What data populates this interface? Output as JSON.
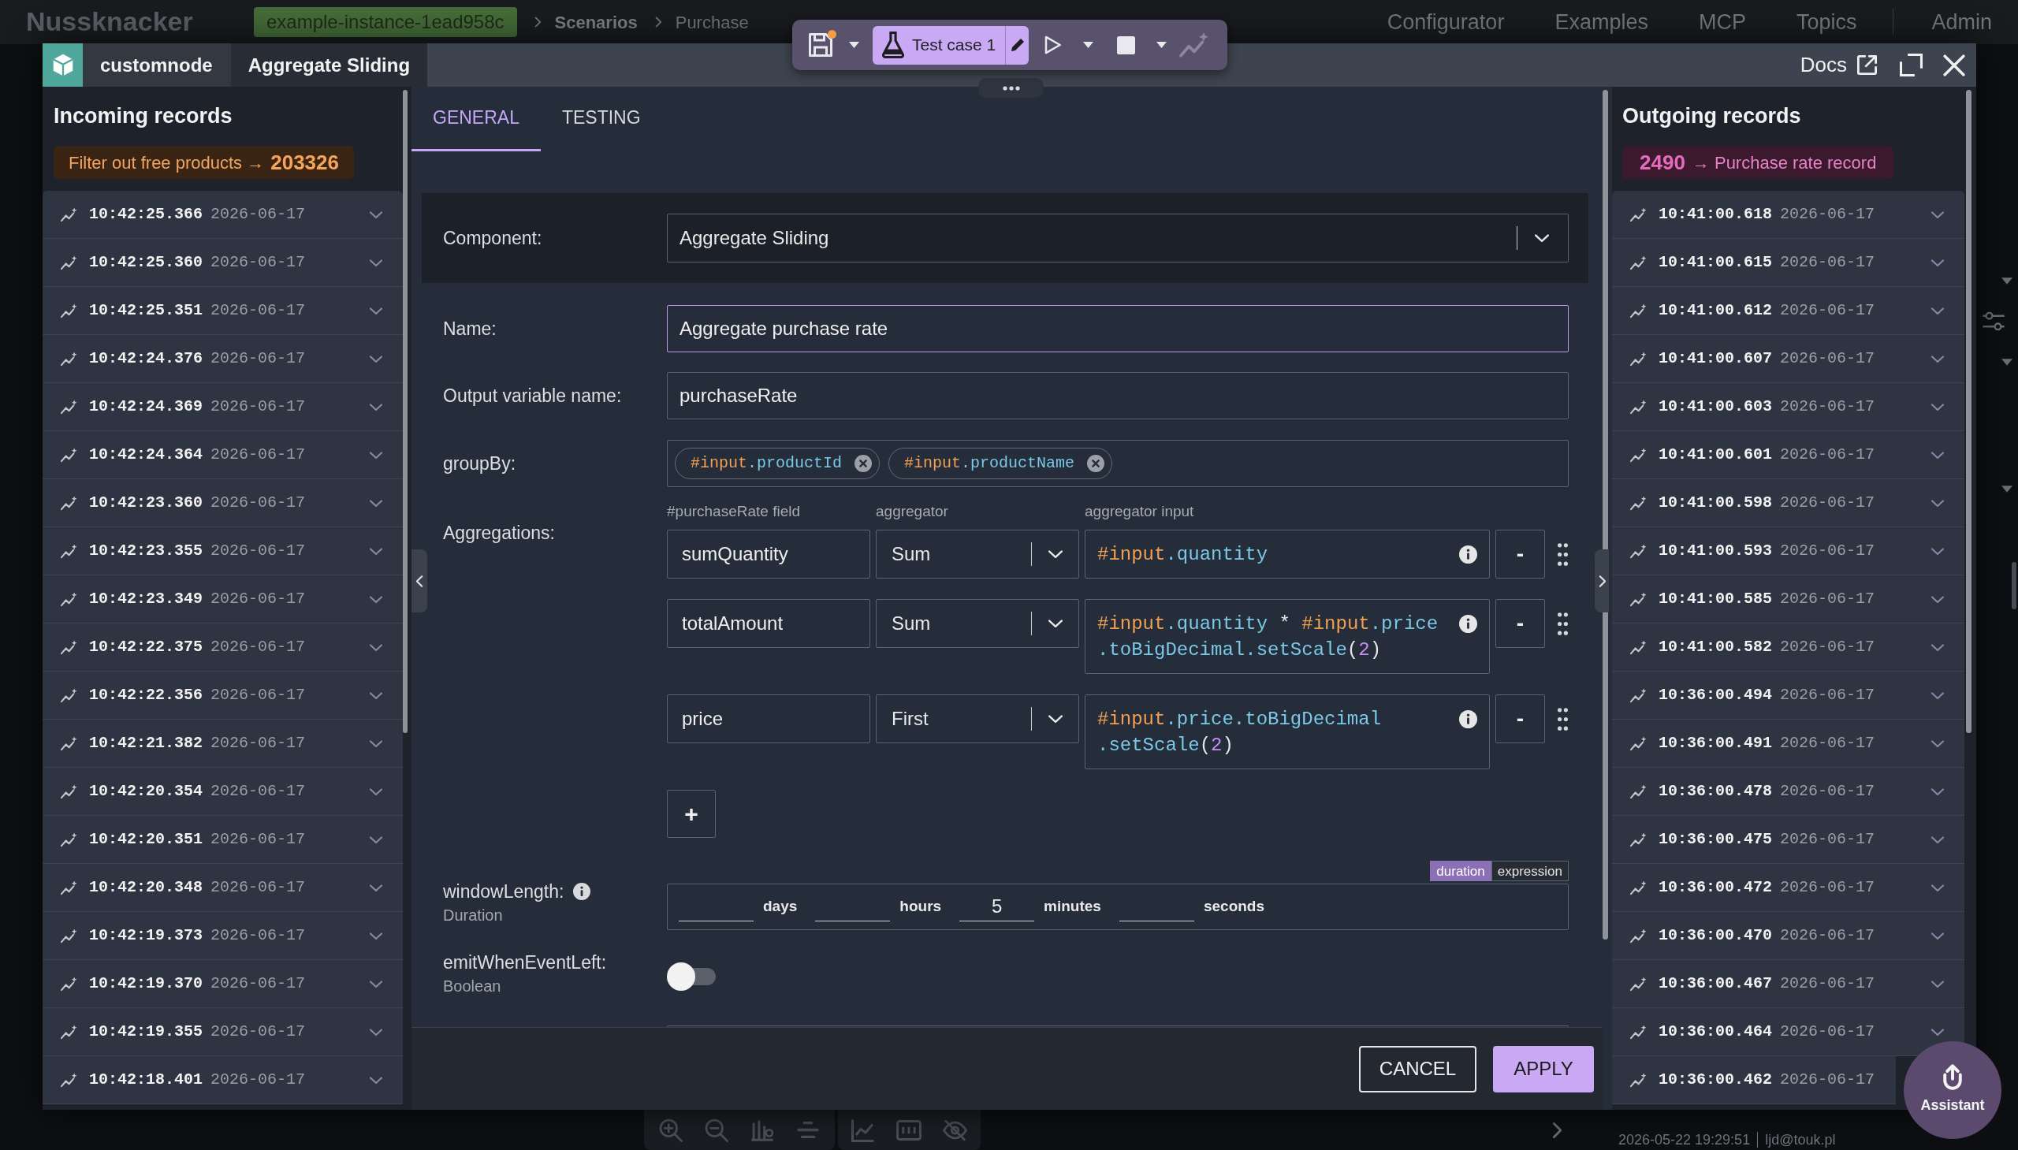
{
  "app_bar": {
    "logo": "Nussknacker",
    "environment": "example-instance-1ead958c",
    "breadcrumbs": [
      {
        "label": "Scenarios",
        "kind": "section"
      },
      {
        "label": "Purchase",
        "kind": "scenario"
      }
    ],
    "nav_links": [
      {
        "label": "Configurator",
        "kind": "link"
      },
      {
        "label": "Examples",
        "kind": "link"
      },
      {
        "label": "MCP",
        "kind": "link"
      },
      {
        "label": "Topics",
        "kind": "link"
      },
      {
        "label": "Admin",
        "kind": "account"
      }
    ]
  },
  "toolbar": {
    "unsaved_changes": true,
    "test_case": "Test case 1"
  },
  "window": {
    "node_type": "customnode",
    "node_name": "Aggregate Sliding",
    "docs_link": "Docs"
  },
  "incoming": {
    "title": "Incoming records",
    "source": "Filter out free products →",
    "count": "203326",
    "records": [
      {
        "time": "10:42:25.366",
        "date": "2026-06-17"
      },
      {
        "time": "10:42:25.360",
        "date": "2026-06-17"
      },
      {
        "time": "10:42:25.351",
        "date": "2026-06-17"
      },
      {
        "time": "10:42:24.376",
        "date": "2026-06-17"
      },
      {
        "time": "10:42:24.369",
        "date": "2026-06-17"
      },
      {
        "time": "10:42:24.364",
        "date": "2026-06-17"
      },
      {
        "time": "10:42:23.360",
        "date": "2026-06-17"
      },
      {
        "time": "10:42:23.355",
        "date": "2026-06-17"
      },
      {
        "time": "10:42:23.349",
        "date": "2026-06-17"
      },
      {
        "time": "10:42:22.375",
        "date": "2026-06-17"
      },
      {
        "time": "10:42:22.356",
        "date": "2026-06-17"
      },
      {
        "time": "10:42:21.382",
        "date": "2026-06-17"
      },
      {
        "time": "10:42:20.354",
        "date": "2026-06-17"
      },
      {
        "time": "10:42:20.351",
        "date": "2026-06-17"
      },
      {
        "time": "10:42:20.348",
        "date": "2026-06-17"
      },
      {
        "time": "10:42:19.373",
        "date": "2026-06-17"
      },
      {
        "time": "10:42:19.370",
        "date": "2026-06-17"
      },
      {
        "time": "10:42:19.355",
        "date": "2026-06-17"
      },
      {
        "time": "10:42:18.401",
        "date": "2026-06-17"
      }
    ]
  },
  "tabs": [
    {
      "label": "GENERAL",
      "selected": true
    },
    {
      "label": "TESTING",
      "selected": false
    }
  ],
  "component": {
    "label": "Component:",
    "value": "Aggregate Sliding"
  },
  "fields": [
    {
      "kind": "text",
      "label": "Name:",
      "value": "Aggregate purchase rate",
      "focused": true
    },
    {
      "kind": "text",
      "label": "Output variable name:",
      "value": "purchaseRate",
      "focused": false
    },
    {
      "kind": "chips",
      "label": "groupBy:",
      "chips": [
        {
          "tokens": [
            {
              "kind": "variable",
              "text": "#input"
            },
            {
              "kind": "property",
              "text": ".productId"
            }
          ]
        },
        {
          "tokens": [
            {
              "kind": "variable",
              "text": "#input"
            },
            {
              "kind": "property",
              "text": ".productName"
            }
          ]
        }
      ]
    },
    {
      "kind": "aggregations",
      "label": "Aggregations:",
      "columns": [
        "#purchaseRate field",
        "aggregator",
        "aggregator input"
      ],
      "rows": [
        {
          "field": "sumQuantity",
          "aggregator": "Sum",
          "remove": "-",
          "lines": [
            [
              {
                "kind": "variable",
                "text": "#input"
              },
              {
                "kind": "property",
                "text": ".quantity"
              }
            ]
          ]
        },
        {
          "field": "totalAmount",
          "aggregator": "Sum",
          "remove": "-",
          "lines": [
            [
              {
                "kind": "variable",
                "text": "#input"
              },
              {
                "kind": "property",
                "text": ".quantity"
              },
              {
                "kind": "operator",
                "text": " * "
              },
              {
                "kind": "variable",
                "text": "#input"
              },
              {
                "kind": "property",
                "text": ".price"
              }
            ],
            [
              {
                "kind": "property",
                "text": ".toBigDecimal.setScale"
              },
              {
                "kind": "punctuation",
                "text": "("
              },
              {
                "kind": "number",
                "text": "2"
              },
              {
                "kind": "punctuation",
                "text": ")"
              }
            ]
          ]
        },
        {
          "field": "price",
          "aggregator": "First",
          "remove": "-",
          "lines": [
            [
              {
                "kind": "variable",
                "text": "#input"
              },
              {
                "kind": "property",
                "text": ".price.toBigDecimal"
              }
            ],
            [
              {
                "kind": "property",
                "text": ".setScale"
              },
              {
                "kind": "punctuation",
                "text": "("
              },
              {
                "kind": "number",
                "text": "2"
              },
              {
                "kind": "punctuation",
                "text": ")"
              }
            ]
          ]
        }
      ],
      "add": "+"
    },
    {
      "kind": "duration",
      "label": "windowLength:",
      "type": "Duration",
      "modes": [
        {
          "label": "duration",
          "selected": true
        },
        {
          "label": "expression",
          "selected": false
        }
      ],
      "parts": [
        {
          "unit": "days"
        },
        {
          "unit": "hours"
        },
        {
          "unit": "minutes",
          "value": "5"
        },
        {
          "unit": "seconds"
        }
      ]
    },
    {
      "kind": "boolean",
      "label": "emitWhenEventLeft:",
      "type": "Boolean",
      "on": false
    }
  ],
  "outgoing": {
    "title": "Outgoing records",
    "count": "2490",
    "target": "→ Purchase rate record",
    "records": [
      {
        "time": "10:41:00.618",
        "date": "2026-06-17"
      },
      {
        "time": "10:41:00.615",
        "date": "2026-06-17"
      },
      {
        "time": "10:41:00.612",
        "date": "2026-06-17"
      },
      {
        "time": "10:41:00.607",
        "date": "2026-06-17"
      },
      {
        "time": "10:41:00.603",
        "date": "2026-06-17"
      },
      {
        "time": "10:41:00.601",
        "date": "2026-06-17"
      },
      {
        "time": "10:41:00.598",
        "date": "2026-06-17"
      },
      {
        "time": "10:41:00.593",
        "date": "2026-06-17"
      },
      {
        "time": "10:41:00.585",
        "date": "2026-06-17"
      },
      {
        "time": "10:41:00.582",
        "date": "2026-06-17"
      },
      {
        "time": "10:36:00.494",
        "date": "2026-06-17"
      },
      {
        "time": "10:36:00.491",
        "date": "2026-06-17"
      },
      {
        "time": "10:36:00.478",
        "date": "2026-06-17"
      },
      {
        "time": "10:36:00.475",
        "date": "2026-06-17"
      },
      {
        "time": "10:36:00.472",
        "date": "2026-06-17"
      },
      {
        "time": "10:36:00.470",
        "date": "2026-06-17"
      },
      {
        "time": "10:36:00.467",
        "date": "2026-06-17"
      },
      {
        "time": "10:36:00.464",
        "date": "2026-06-17"
      },
      {
        "time": "10:36:00.462",
        "date": "2026-06-17"
      }
    ]
  },
  "footer_buttons": [
    {
      "label": "CANCEL",
      "kind": "outlined"
    },
    {
      "label": "APPLY",
      "kind": "primary"
    }
  ],
  "canvas_footer": {
    "timestamp": "2026-05-22 19:29:51",
    "user": "ljd@touk.pl"
  },
  "assistant": {
    "label": "Assistant"
  }
}
